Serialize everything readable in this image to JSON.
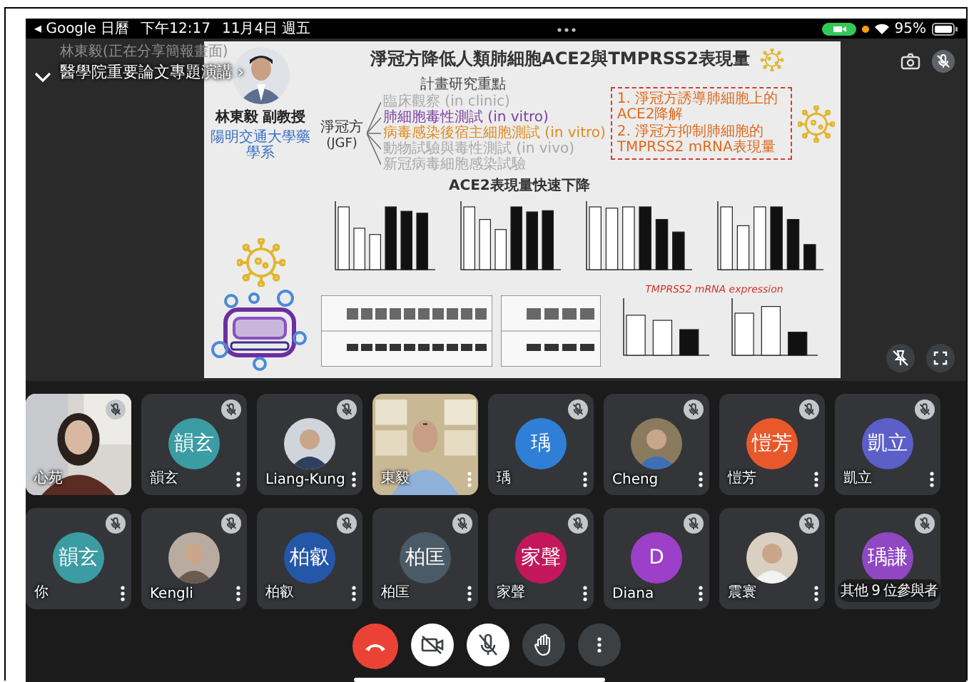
{
  "status_bar": {
    "back_app": "◂ Google 日曆",
    "time": "下午12:17",
    "date": "11月4日 週五",
    "battery": "95%"
  },
  "meeting": {
    "presenting_note": "林東毅(正在分享簡報畫面)",
    "title": "醫學院重要論文專題演講 ›"
  },
  "slide": {
    "title": "淨冠方降低人類肺細胞ACE2與TMPRSS2表現量",
    "presenter_name": "林東毅 副教授",
    "presenter_affiliation": "陽明交通大學藥學系",
    "focus_heading": "計畫研究重點",
    "compound": [
      "淨冠方",
      "(JGF)"
    ],
    "branches": [
      {
        "text": "臨床觀察 (in clinic)",
        "color": "#a8a8a8"
      },
      {
        "text": "肺細胞毒性測試 (in vitro)",
        "color": "#7b3fa0"
      },
      {
        "text": "病毒感染後宿主細胞測試 (in vitro)",
        "color": "#e08a1e"
      },
      {
        "text": "動物試驗與毒性測試 (in vivo)",
        "color": "#a8a8a8"
      },
      {
        "text": "新冠病毒細胞感染試驗",
        "color": "#a8a8a8"
      }
    ],
    "findings": [
      "1. 淨冠方誘導肺細胞上的ACE2降解",
      "2. 淨冠方抑制肺細胞的TMPRSS2 mRNA表現量"
    ],
    "chart_heading": "ACE2表現量快速下降",
    "mrna_caption": "TMPRSS2 mRNA expression"
  },
  "tiles": [
    {
      "kind": "video",
      "name": "心苑",
      "muted": true,
      "menu": false
    },
    {
      "kind": "initials",
      "initials": "韻玄",
      "color": "#3b9ca3",
      "name": "韻玄",
      "muted": true,
      "menu": true
    },
    {
      "name": "Liang-Kung",
      "muted": true,
      "menu": true
    },
    {
      "kind": "video",
      "name": "東毅",
      "muted": false,
      "menu": true
    },
    {
      "kind": "initials",
      "initials": "瑀",
      "color": "#2f7fd6",
      "name": "瑀",
      "muted": true,
      "menu": true
    },
    {
      "name": "Cheng",
      "muted": true,
      "menu": true
    },
    {
      "kind": "initials",
      "initials": "愷芳",
      "color": "#e8582b",
      "name": "愷芳",
      "muted": true,
      "menu": true
    },
    {
      "kind": "initials",
      "initials": "凱立",
      "color": "#5b5fc7",
      "name": "凱立",
      "muted": true,
      "menu": true
    },
    {
      "kind": "initials",
      "initials": "韻玄",
      "color": "#3b9ca3",
      "name": "你",
      "muted": true,
      "menu": true
    },
    {
      "name": "Kengli",
      "muted": true,
      "menu": true
    },
    {
      "kind": "initials",
      "initials": "柏叡",
      "color": "#2457a8",
      "name": "柏叡",
      "muted": true,
      "menu": true
    },
    {
      "kind": "initials",
      "initials": "柏匡",
      "color": "#4a5a66",
      "name": "柏匡",
      "muted": true,
      "menu": true
    },
    {
      "kind": "initials",
      "initials": "家聲",
      "color": "#c2185b",
      "name": "家聲",
      "muted": true,
      "menu": true
    },
    {
      "kind": "initials",
      "initials": "D",
      "color": "#9c3fc9",
      "name": "Diana",
      "muted": true,
      "menu": true
    },
    {
      "name": "震寰",
      "muted": true,
      "menu": true
    },
    {
      "kind": "overflow",
      "initials": "瑀謙",
      "color": "#8f47c2",
      "name": "其他 9 位參與者",
      "muted": true,
      "menu": false
    }
  ],
  "controls": [
    {
      "kind": "end-call"
    },
    {
      "kind": "camera",
      "on": false
    },
    {
      "kind": "mic",
      "on": false
    },
    {
      "kind": "hand"
    },
    {
      "kind": "more"
    }
  ]
}
